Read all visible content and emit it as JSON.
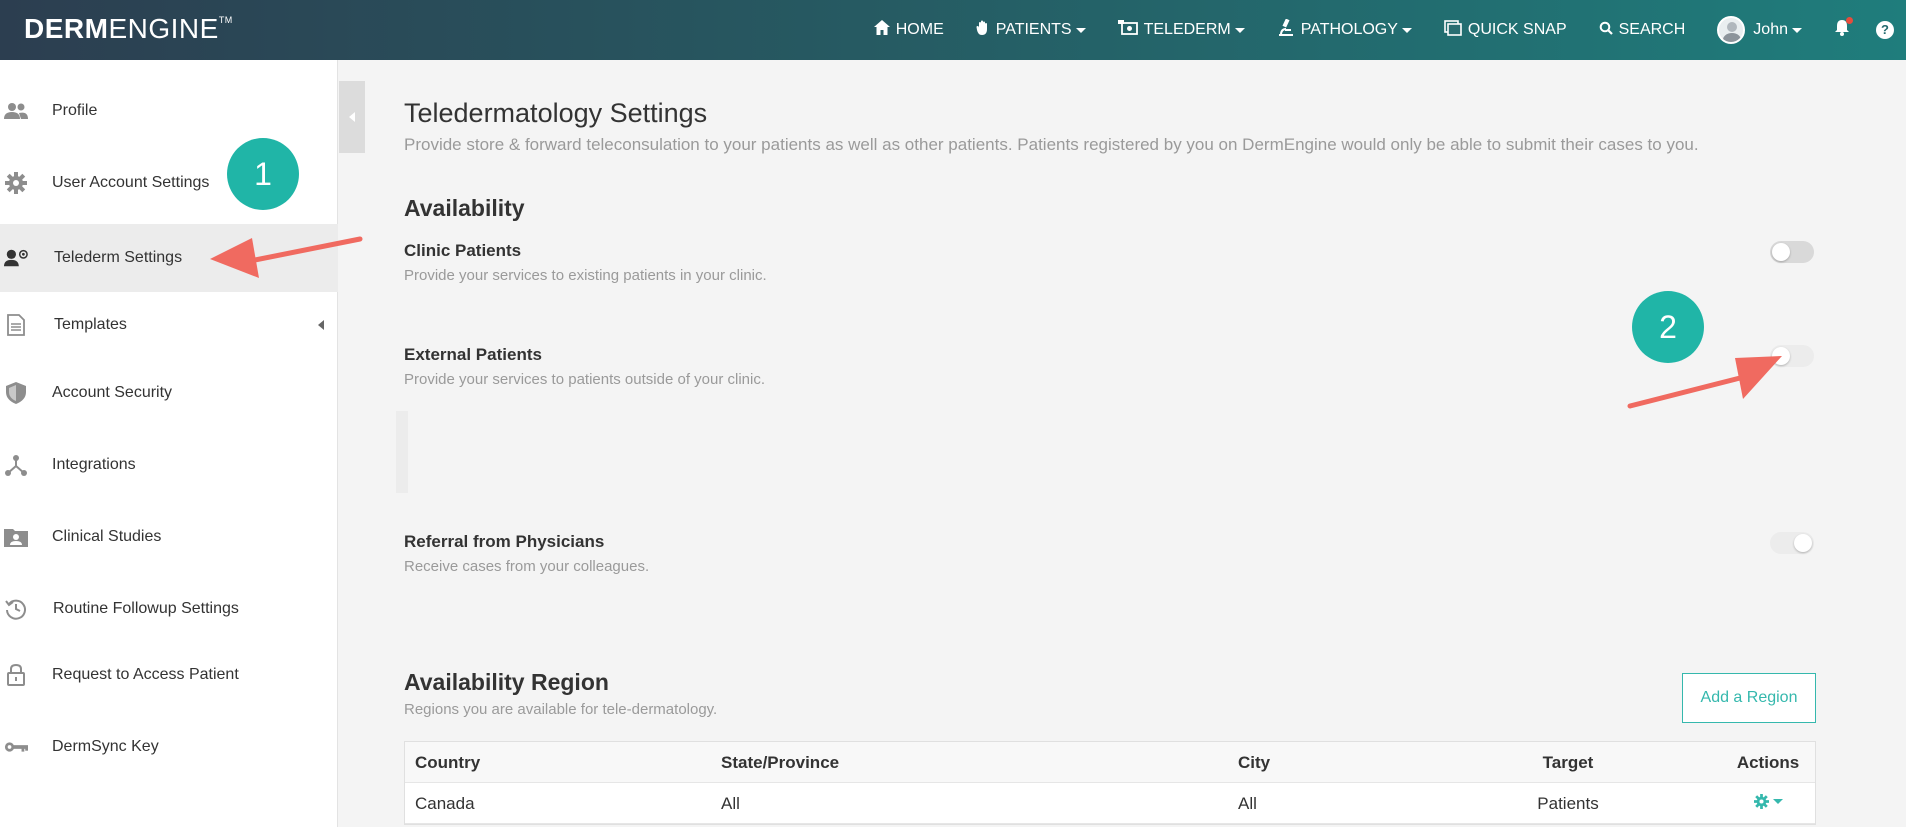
{
  "app": {
    "logo_bold": "DERM",
    "logo_light": "ENGINE",
    "logo_tm": "TM"
  },
  "nav": {
    "home": "HOME",
    "patients": "PATIENTS",
    "telederm": "TELEDERM",
    "pathology": "PATHOLOGY",
    "quick_snap": "QUICK SNAP",
    "search": "SEARCH",
    "user": "John",
    "help": "?"
  },
  "sidebar": {
    "items": [
      {
        "label": "Profile",
        "icon": "users-icon"
      },
      {
        "label": "User Account Settings",
        "icon": "gear-icon"
      },
      {
        "label": "Telederm Settings",
        "icon": "telederm-icon"
      },
      {
        "label": "Templates",
        "icon": "document-icon"
      },
      {
        "label": "Account Security",
        "icon": "shield-icon"
      },
      {
        "label": "Integrations",
        "icon": "network-icon"
      },
      {
        "label": "Clinical Studies",
        "icon": "folder-user-icon"
      },
      {
        "label": "Routine Followup Settings",
        "icon": "history-icon"
      },
      {
        "label": "Request to Access Patient",
        "icon": "lock-icon"
      },
      {
        "label": "DermSync Key",
        "icon": "key-icon"
      }
    ]
  },
  "main": {
    "title": "Teledermatology Settings",
    "subtitle": "Provide store & forward teleconsulation to your patients as well as other patients. Patients registered by you on DermEngine would only be able to submit their cases to you.",
    "availability": {
      "heading": "Availability",
      "options": [
        {
          "title": "Clinic Patients",
          "desc": "Provide your services to existing patients in your clinic.",
          "state": "off"
        },
        {
          "title": "External Patients",
          "desc": "Provide your services to patients outside of your clinic.",
          "state": "off"
        },
        {
          "title": "Referral from Physicians",
          "desc": "Receive cases from your colleagues.",
          "state": "on"
        }
      ]
    },
    "region": {
      "heading": "Availability Region",
      "desc": "Regions you are available for tele-dermatology.",
      "add_button": "Add a Region",
      "columns": [
        "Country",
        "State/Province",
        "City",
        "Target",
        "Actions"
      ],
      "rows": [
        {
          "country": "Canada",
          "state": "All",
          "city": "All",
          "target": "Patients"
        }
      ]
    }
  },
  "annotations": {
    "step1": "1",
    "step2": "2"
  },
  "colors": {
    "accent": "#35b8ad",
    "badge": "#20b5a7",
    "arrow": "#f06a60"
  }
}
